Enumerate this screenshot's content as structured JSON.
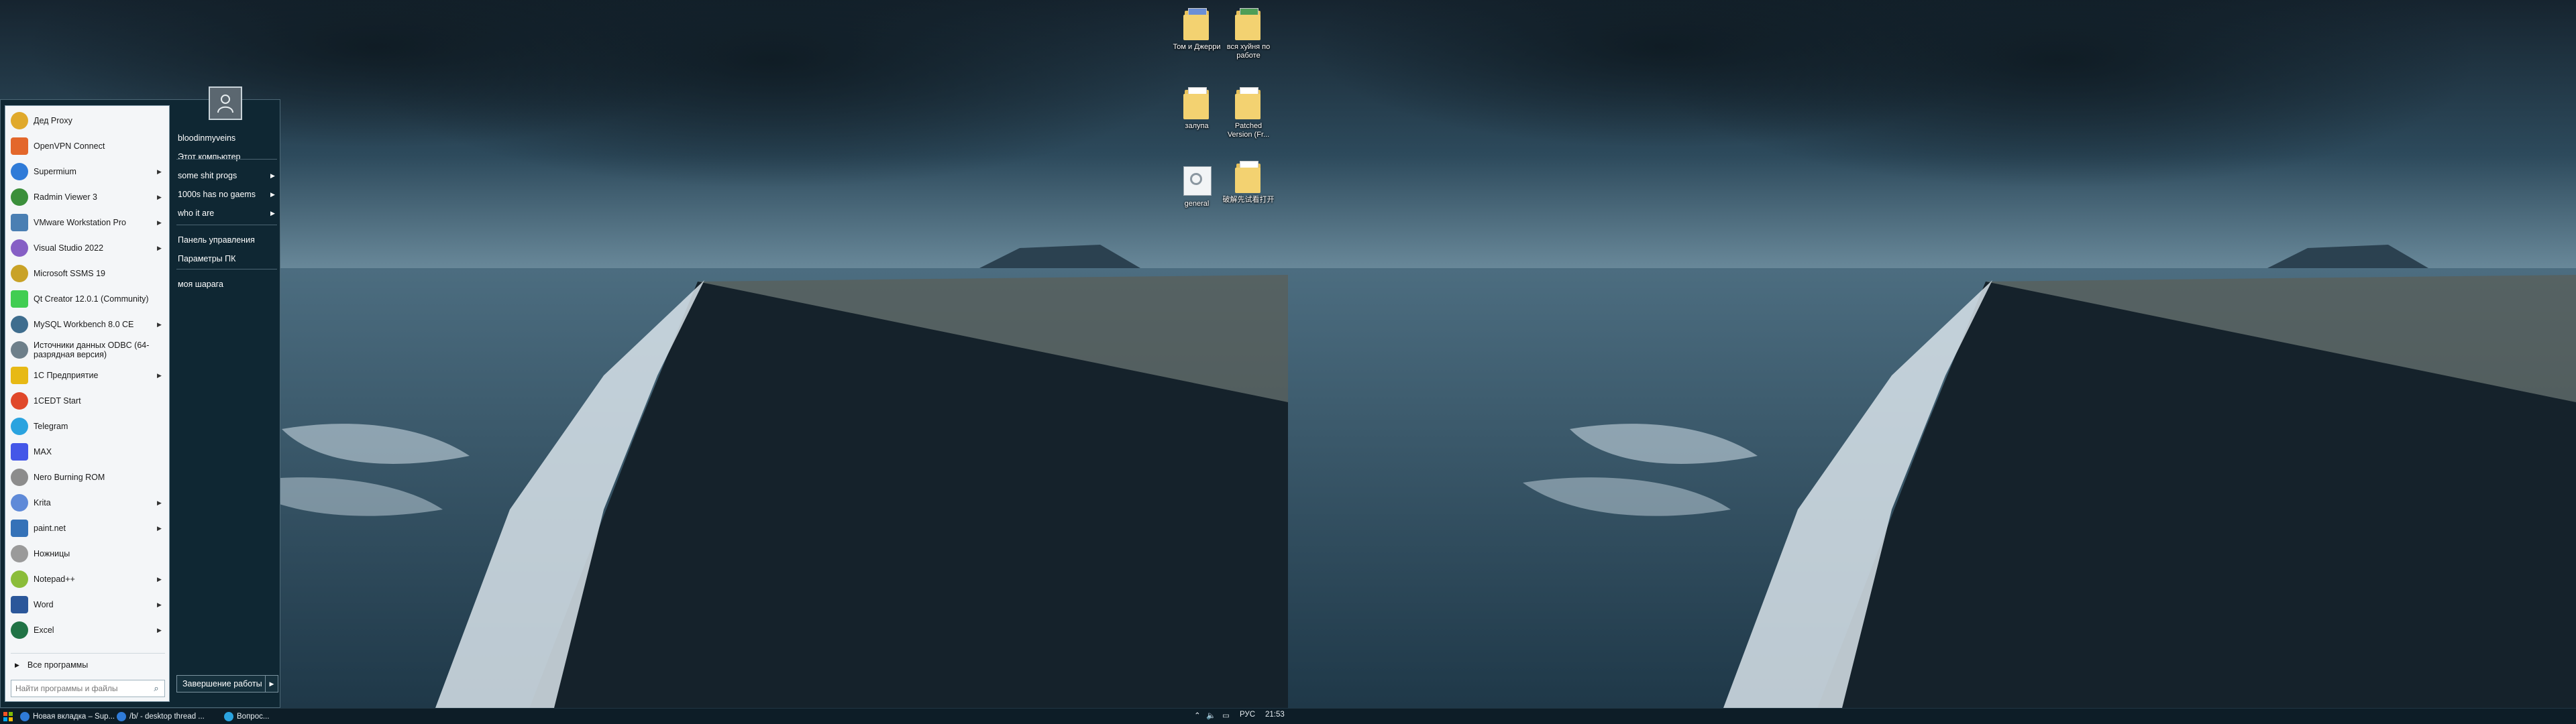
{
  "desktop_icons": [
    {
      "id": "tom",
      "label": "Том и Джерри"
    },
    {
      "id": "vse",
      "label": "вся хуйня по работе"
    },
    {
      "id": "zalupa",
      "label": "залупа"
    },
    {
      "id": "patched",
      "label": "Patched Version (Fr..."
    },
    {
      "id": "general",
      "label": "general"
    },
    {
      "id": "cn",
      "label": "破解先试看打开"
    }
  ],
  "start_menu": {
    "programs": [
      {
        "label": "Дед Proxy",
        "icon": "proxy-icon",
        "color": "#e0a92b",
        "arrow": false
      },
      {
        "label": "OpenVPN Connect",
        "icon": "openvpn-icon",
        "color": "#e3672b",
        "arrow": false
      },
      {
        "label": "Supermium",
        "icon": "supermium-icon",
        "color": "#2f7bd8",
        "arrow": true
      },
      {
        "label": "Radmin Viewer 3",
        "icon": "radmin-icon",
        "color": "#3b8f3b",
        "arrow": true
      },
      {
        "label": "VMware Workstation Pro",
        "icon": "vmware-icon",
        "color": "#4a7fb3",
        "arrow": true
      },
      {
        "label": "Visual Studio 2022",
        "icon": "visual-studio-icon",
        "color": "#865fc5",
        "arrow": true
      },
      {
        "label": "Microsoft SSMS 19",
        "icon": "ssms-icon",
        "color": "#c9a227",
        "arrow": false
      },
      {
        "label": "Qt Creator 12.0.1 (Community)",
        "icon": "qt-icon",
        "color": "#41cd52",
        "arrow": false
      },
      {
        "label": "MySQL Workbench 8.0 CE",
        "icon": "mysql-icon",
        "color": "#3e6d8e",
        "arrow": true
      },
      {
        "label": "Источники данных ODBC (64-разрядная версия)",
        "icon": "odbc-icon",
        "color": "#6d7f8a",
        "arrow": false
      },
      {
        "label": "1С Предприятие",
        "icon": "1c-icon",
        "color": "#e7b915",
        "arrow": true
      },
      {
        "label": "1CEDT Start",
        "icon": "1cedt-icon",
        "color": "#e0482a",
        "arrow": false
      },
      {
        "label": "Telegram",
        "icon": "telegram-icon",
        "color": "#2aa3df",
        "arrow": false
      },
      {
        "label": "MAX",
        "icon": "max-icon",
        "color": "#4457e8",
        "arrow": false
      },
      {
        "label": "Nero Burning ROM",
        "icon": "nero-icon",
        "color": "#8c8c8c",
        "arrow": false
      },
      {
        "label": "Krita",
        "icon": "krita-icon",
        "color": "#5f8ad8",
        "arrow": true
      },
      {
        "label": "paint.net",
        "icon": "paintnet-icon",
        "color": "#3572b8",
        "arrow": true
      },
      {
        "label": "Ножницы",
        "icon": "scissors-icon",
        "color": "#9a9a9a",
        "arrow": false
      },
      {
        "label": "Notepad++",
        "icon": "notepadpp-icon",
        "color": "#8bbd3a",
        "arrow": true
      },
      {
        "label": "Word",
        "icon": "word-icon",
        "color": "#2b579a",
        "arrow": true
      },
      {
        "label": "Excel",
        "icon": "excel-icon",
        "color": "#217346",
        "arrow": true
      }
    ],
    "all_programs_label": "Все программы",
    "search_placeholder": "Найти программы и файлы",
    "right_items": [
      {
        "label": "bloodinmyveins",
        "arrow": false
      },
      {
        "label": "Этот компьютер",
        "arrow": false
      },
      {
        "label": "some shit progs",
        "arrow": true
      },
      {
        "label": "1000s has no gaems",
        "arrow": true
      },
      {
        "label": "who it are",
        "arrow": true
      },
      {
        "label": "Панель управления",
        "arrow": false
      },
      {
        "label": "Параметры ПК",
        "arrow": false
      },
      {
        "label": "моя шарага",
        "arrow": false
      }
    ],
    "shutdown_label": "Завершение работы"
  },
  "taskbar": {
    "items": [
      {
        "label": "Новая вкладка – Sup...",
        "color": "#2f7bd8"
      },
      {
        "label": "/b/ - desktop thread ...",
        "color": "#2f7bd8"
      },
      {
        "label": "Вопрос...",
        "color": "#2aa3df"
      }
    ],
    "language": "РУС",
    "clock": "21:53"
  }
}
